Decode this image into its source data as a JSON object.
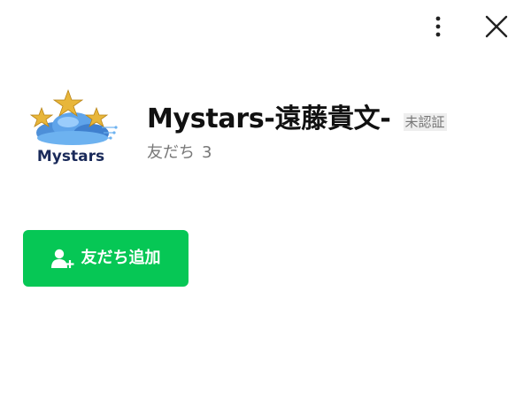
{
  "header": {
    "more_icon": "vertical-dots-icon",
    "close_icon": "close-icon"
  },
  "profile": {
    "avatar": {
      "logo_text": "Mystars",
      "logo_colors": {
        "stars": "#e8b63a",
        "cloud": "#5a9ee0",
        "text": "#1a2a5a"
      }
    },
    "name": "Mystars-遠藤貴文-",
    "verification_badge": "未認証",
    "friends_label": "友だち",
    "friends_count": "3"
  },
  "actions": {
    "add_friend_label": "友だち追加",
    "add_friend_icon": "add-person-icon",
    "button_color": "#06c755"
  }
}
